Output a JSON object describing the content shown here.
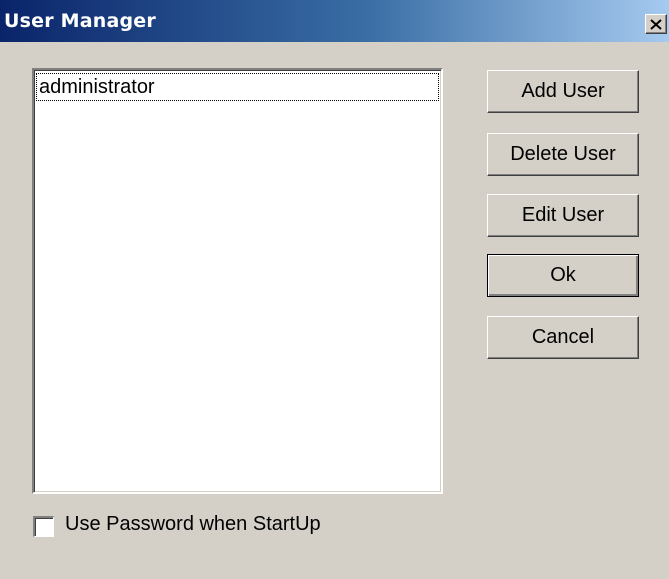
{
  "window": {
    "title": "User Manager"
  },
  "users": [
    "administrator"
  ],
  "buttons": {
    "add_user": "Add User",
    "delete_user": "Delete User",
    "edit_user": "Edit User",
    "ok": "Ok",
    "cancel": "Cancel"
  },
  "password_option": {
    "label": "Use Password when StartUp",
    "checked": false
  },
  "colors": {
    "dialog_bg": "#d4d0c8",
    "title_gradient_start": "#0a246a",
    "title_gradient_end": "#a6caf0"
  },
  "icons": {
    "close": "close-icon"
  }
}
